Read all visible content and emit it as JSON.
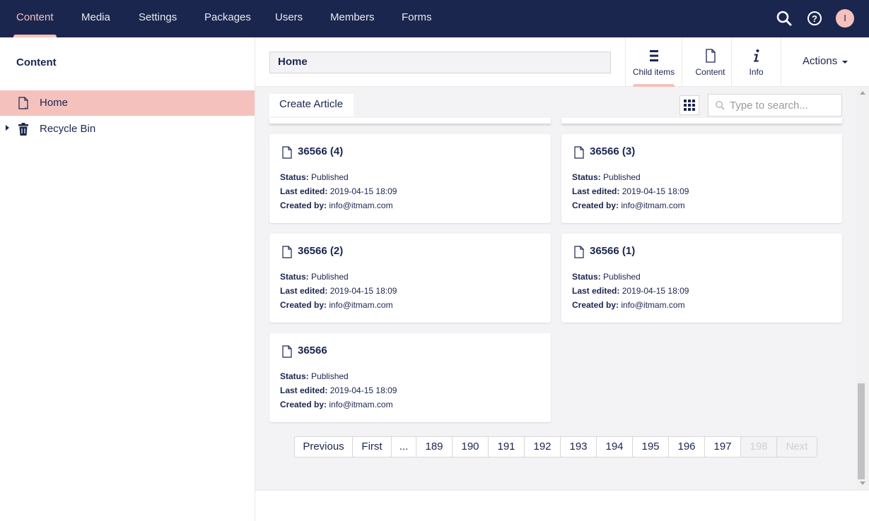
{
  "nav": {
    "items": [
      {
        "label": "Content",
        "active": true
      },
      {
        "label": "Media"
      },
      {
        "label": "Settings"
      },
      {
        "label": "Packages"
      },
      {
        "label": "Users"
      },
      {
        "label": "Members"
      },
      {
        "label": "Forms"
      }
    ],
    "avatar_initial": "I",
    "icons": [
      "search-icon",
      "help-icon"
    ]
  },
  "tree": {
    "title": "Content",
    "items": [
      {
        "label": "Home",
        "icon": "document-icon",
        "selected": true
      },
      {
        "label": "Recycle Bin",
        "icon": "trash-icon"
      }
    ]
  },
  "editor": {
    "name": "Home",
    "apps": [
      {
        "label": "Child items",
        "icon": "list-icon",
        "active": true
      },
      {
        "label": "Content",
        "icon": "document-icon"
      },
      {
        "label": "Info",
        "icon": "info-icon"
      }
    ],
    "actions_label": "Actions"
  },
  "listview": {
    "create_label": "Create Article",
    "search_placeholder": "Type to search...",
    "cards": [
      {
        "title": "36566 (4)",
        "status_label": "Status:",
        "status": "Published",
        "edited_label": "Last edited:",
        "edited": "2019-04-15 18:09",
        "created_label": "Created by:",
        "created": "info@itmam.com"
      },
      {
        "title": "36566 (3)",
        "status_label": "Status:",
        "status": "Published",
        "edited_label": "Last edited:",
        "edited": "2019-04-15 18:09",
        "created_label": "Created by:",
        "created": "info@itmam.com"
      },
      {
        "title": "36566 (2)",
        "status_label": "Status:",
        "status": "Published",
        "edited_label": "Last edited:",
        "edited": "2019-04-15 18:09",
        "created_label": "Created by:",
        "created": "info@itmam.com"
      },
      {
        "title": "36566 (1)",
        "status_label": "Status:",
        "status": "Published",
        "edited_label": "Last edited:",
        "edited": "2019-04-15 18:09",
        "created_label": "Created by:",
        "created": "info@itmam.com"
      },
      {
        "title": "36566",
        "status_label": "Status:",
        "status": "Published",
        "edited_label": "Last edited:",
        "edited": "2019-04-15 18:09",
        "created_label": "Created by:",
        "created": "info@itmam.com"
      }
    ],
    "pagination": [
      {
        "label": "Previous"
      },
      {
        "label": "First"
      },
      {
        "label": "..."
      },
      {
        "label": "189"
      },
      {
        "label": "190"
      },
      {
        "label": "191"
      },
      {
        "label": "192"
      },
      {
        "label": "193"
      },
      {
        "label": "194"
      },
      {
        "label": "195"
      },
      {
        "label": "196"
      },
      {
        "label": "197"
      },
      {
        "label": "198",
        "disabled": true
      },
      {
        "label": "Next",
        "disabled": true
      }
    ]
  },
  "colors": {
    "header_bg": "#1b264f",
    "accent": "#f5c1bc",
    "text": "#1b264f",
    "panel_bg": "#f3f3f5"
  }
}
